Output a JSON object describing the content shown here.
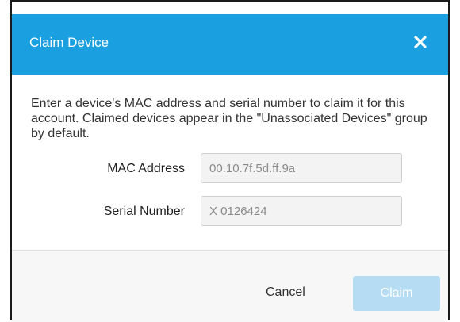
{
  "dialog": {
    "title": "Claim Device",
    "description": "Enter a device's MAC address and serial number to claim it for this account. Claimed devices appear in the \"Unassociated Devices\" group by default.",
    "fields": {
      "mac": {
        "label": "MAC Address",
        "value": "00.10.7f.5d.ff.9a"
      },
      "serial": {
        "label": "Serial Number",
        "value": "X 0126424"
      }
    },
    "buttons": {
      "cancel": "Cancel",
      "claim": "Claim",
      "close_icon": "close-icon"
    },
    "colors": {
      "header": "#1a9fe0",
      "claim_disabled": "#b6dcf3",
      "footer": "#f7f7f7"
    }
  }
}
